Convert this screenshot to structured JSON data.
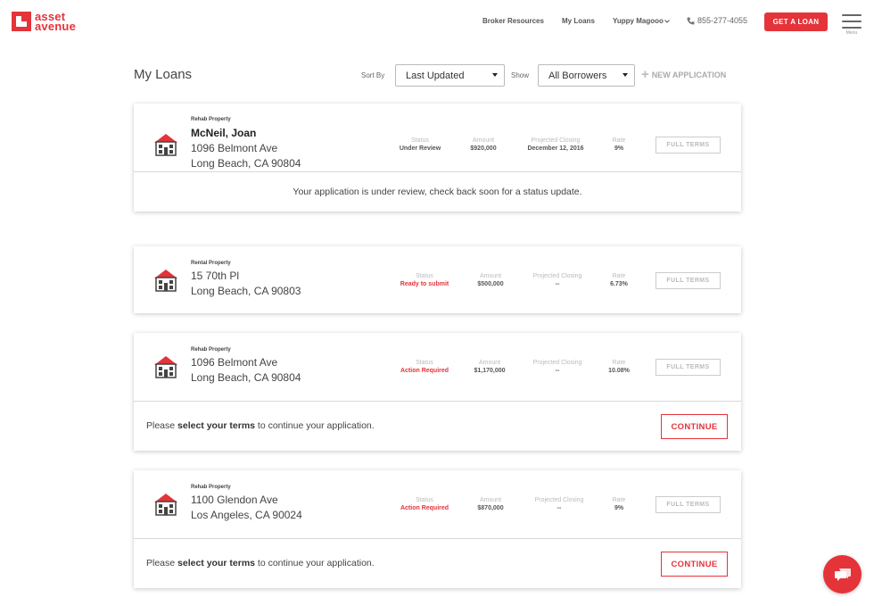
{
  "brand": {
    "line1": "asset",
    "line2": "avenue",
    "accent": "#e5333a"
  },
  "nav": {
    "broker_resources": "Broker Resources",
    "my_loans": "My Loans",
    "user": "Yuppy Magooo",
    "phone": "855-277-4055",
    "get_loan": "GET A LOAN",
    "menu_label": "Menu"
  },
  "toolbar": {
    "title": "My Loans",
    "sort_label": "Sort By",
    "sort_value": "Last Updated",
    "show_label": "Show",
    "show_value": "All Borrowers",
    "new_application": "NEW APPLICATION"
  },
  "labels": {
    "status": "Status",
    "amount": "Amount",
    "projected_closing": "Projected Closing",
    "rate": "Rate",
    "full_terms": "FULL TERMS",
    "continue": "CONTINUE"
  },
  "loans": [
    {
      "type": "Rehab Property",
      "name": "McNeil, Joan",
      "street": "1096 Belmont Ave",
      "city": "Long Beach, CA 90804",
      "status": "Under Review",
      "amount": "$920,000",
      "closing": "December 12, 2016",
      "rate": "9%",
      "message": "Your application is under review, check back soon for a status update."
    },
    {
      "type": "Rental Property",
      "street": "15 70th Pl",
      "city": "Long Beach, CA 90803",
      "status": "Ready to submit",
      "amount": "$500,000",
      "closing": "--",
      "rate": "6.73%"
    },
    {
      "type": "Rehab Property",
      "street": "1096 Belmont Ave",
      "city": "Long Beach, CA 90804",
      "status": "Action Required",
      "amount": "$1,170,000",
      "closing": "--",
      "rate": "10.08%",
      "action_pre": "Please ",
      "action_bold": "select your terms",
      "action_post": " to continue your application."
    },
    {
      "type": "Rehab Property",
      "street": "1100 Glendon Ave",
      "city": "Los Angeles, CA 90024",
      "status": "Action Required",
      "amount": "$870,000",
      "closing": "--",
      "rate": "9%",
      "action_pre": "Please ",
      "action_bold": "select your terms",
      "action_post": " to continue your application."
    }
  ],
  "icons": {
    "house": "house-icon",
    "phone": "phone-icon",
    "chat": "chat-icon",
    "menu": "hamburger-menu-icon"
  }
}
